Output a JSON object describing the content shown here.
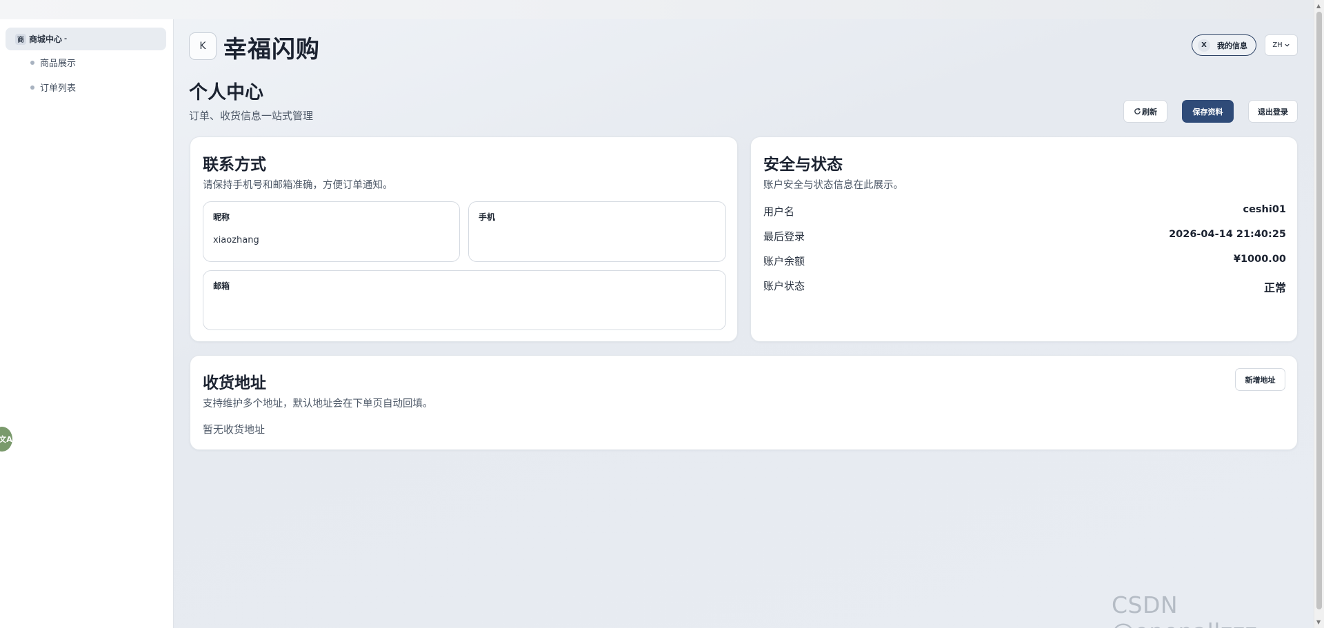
{
  "sidebar": {
    "group_badge": "商",
    "group_label": "商城中心",
    "group_caret": "-",
    "items": [
      {
        "label": "商品展示"
      },
      {
        "label": "订单列表"
      }
    ]
  },
  "floating_badge": "文A",
  "header": {
    "back_label": "K",
    "brand": "幸福闪购",
    "user_avatar": "X",
    "user_label": "我的信息",
    "lang": "ZH"
  },
  "page": {
    "title": "个人中心",
    "subtitle": "订单、收货信息一站式管理"
  },
  "actions": {
    "refresh": "刷新",
    "save": "保存资料",
    "logout": "退出登录"
  },
  "contact": {
    "title": "联系方式",
    "desc": "请保持手机号和邮箱准确，方便订单通知。",
    "nickname_label": "昵称",
    "nickname_value": "xiaozhang",
    "phone_label": "手机",
    "phone_value": "",
    "email_label": "邮箱",
    "email_value": ""
  },
  "security": {
    "title": "安全与状态",
    "desc": "账户安全与状态信息在此展示。",
    "rows": [
      {
        "label": "用户名",
        "value": "ceshi01"
      },
      {
        "label": "最后登录",
        "value": "2026-04-14 21:40:25"
      },
      {
        "label": "账户余额",
        "value": "¥1000.00"
      },
      {
        "label": "账户状态",
        "value": "正常"
      }
    ]
  },
  "address": {
    "title": "收货地址",
    "desc": "支持维护多个地址，默认地址会在下单页自动回填。",
    "add_label": "新增地址",
    "empty": "暂无收货地址"
  },
  "watermark": "CSDN @openallzzz",
  "colors": {
    "primary": "#2f4b78",
    "sidebar_active": "#e8ecf1",
    "floating_badge": "#7a9a6c"
  }
}
